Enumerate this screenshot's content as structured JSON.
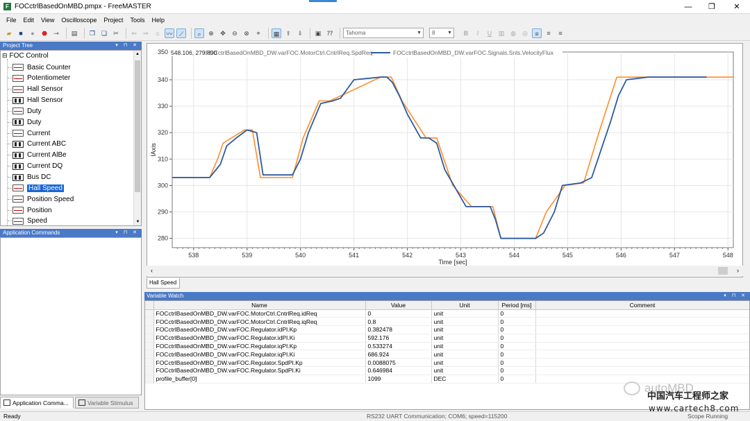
{
  "window": {
    "title": "FOCctrlBasedOnMBD.pmpx - FreeMASTER",
    "icon": "freemaster-app-icon",
    "controls": [
      "—",
      "❐",
      "✕"
    ]
  },
  "menu": [
    "File",
    "Edit",
    "View",
    "Oscilloscope",
    "Project",
    "Tools",
    "Help"
  ],
  "toolbar": {
    "font_name": "Tahoma",
    "font_size": "8"
  },
  "project_tree": {
    "header": "Project Tree",
    "root": "FOC Control",
    "selected": "Hall Speed",
    "items": [
      {
        "label": "Basic Counter",
        "icon": "oscilloscope-icon"
      },
      {
        "label": "Potentiometer",
        "icon": "oscilloscope-icon"
      },
      {
        "label": "Hall Sensor",
        "icon": "oscilloscope-icon"
      },
      {
        "label": "Hall Sensor",
        "icon": "recorder-icon"
      },
      {
        "label": "Duty",
        "icon": "oscilloscope-icon"
      },
      {
        "label": "Duty",
        "icon": "recorder-icon"
      },
      {
        "label": "Current",
        "icon": "oscilloscope-icon"
      },
      {
        "label": "Current ABC",
        "icon": "recorder-icon"
      },
      {
        "label": "Current AlBe",
        "icon": "recorder-icon"
      },
      {
        "label": "Current DQ",
        "icon": "recorder-icon"
      },
      {
        "label": "Bus DC",
        "icon": "recorder-icon"
      },
      {
        "label": "Hall Speed",
        "icon": "oscilloscope-icon"
      },
      {
        "label": "Position Speed",
        "icon": "oscilloscope-icon"
      },
      {
        "label": "Position",
        "icon": "oscilloscope-icon"
      },
      {
        "label": "Speed",
        "icon": "oscilloscope-icon"
      }
    ]
  },
  "app_commands": {
    "header": "Application Commands"
  },
  "bottom_tabs": [
    "Application Comma...",
    "Variable Stimulus"
  ],
  "scope": {
    "tab": "Hall Speed",
    "cursor_readout": "548.106, 279.890"
  },
  "chart_data": {
    "type": "line",
    "xlabel": "Time [sec]",
    "ylabel": "IAxis",
    "xlim": [
      537.6,
      548.1
    ],
    "ylim": [
      276.5,
      350.5
    ],
    "x_ticks": [
      538,
      539,
      540,
      541,
      542,
      543,
      544,
      545,
      546,
      547,
      548
    ],
    "y_ticks": [
      280,
      290,
      300,
      310,
      320,
      330,
      340
    ],
    "y_top_partial_tick": "350",
    "grid": true,
    "legend": "top",
    "series": [
      {
        "name": "FOCctrlBasedOnMBD_DW.varFOC.MotorCtrl.CntrlReq.SpdReq",
        "color": "#ff8c2a",
        "x": [
          537.6,
          538.3,
          538.45,
          538.55,
          538.95,
          539.1,
          539.25,
          539.85,
          540.05,
          540.35,
          540.55,
          541.5,
          541.7,
          541.9,
          542.35,
          542.55,
          542.85,
          543.2,
          543.6,
          543.75,
          544.4,
          544.6,
          544.95,
          545.3,
          545.6,
          545.92,
          548.1
        ],
        "y": [
          303,
          303,
          310,
          316,
          321,
          321,
          303,
          303,
          318,
          332,
          332,
          341,
          341,
          332,
          318,
          318,
          300,
          292,
          292,
          280,
          280,
          290,
          300,
          301,
          321,
          341,
          341
        ]
      },
      {
        "name": "FOCctrlBasedOnMBD_DW.varFOC.Signals.Snls.VelocityFlux",
        "color": "#2c5aa0",
        "x": [
          537.6,
          538.3,
          538.5,
          538.62,
          538.8,
          539.0,
          539.18,
          539.3,
          539.85,
          540.0,
          540.15,
          540.38,
          540.6,
          540.75,
          541.0,
          541.5,
          541.62,
          541.72,
          541.85,
          542.0,
          542.25,
          542.4,
          542.55,
          542.7,
          542.9,
          543.1,
          543.25,
          543.55,
          543.65,
          543.75,
          544.4,
          544.55,
          544.75,
          544.9,
          545.25,
          545.45,
          545.6,
          545.8,
          545.95,
          546.1,
          546.5,
          547.0,
          547.6
        ],
        "y": [
          303,
          303,
          308,
          315,
          318,
          321,
          320,
          304,
          304,
          310,
          320,
          331,
          332,
          333,
          340,
          341,
          341,
          339,
          334,
          327,
          318,
          318,
          316,
          306,
          299,
          292,
          292,
          292,
          287,
          280,
          280,
          282,
          290,
          300,
          301,
          303,
          312,
          324,
          334,
          340,
          341,
          341,
          341
        ]
      }
    ]
  },
  "variable_watch": {
    "header": "Variable Watch",
    "columns": [
      "Name",
      "Value",
      "Unit",
      "Period [ms]",
      "Comment"
    ],
    "rows": [
      [
        "FOCctrlBasedOnMBD_DW.varFOC.MotorCtrl.CntrlReq.idReq",
        "0",
        "unit",
        "0",
        ""
      ],
      [
        "FOCctrlBasedOnMBD_DW.varFOC.MotorCtrl.CntrlReq.iqReq",
        "0.8",
        "unit",
        "0",
        ""
      ],
      [
        "FOCctrlBasedOnMBD_DW.varFOC.Regulator.idPI.Kp",
        "0.382478",
        "unit",
        "0",
        ""
      ],
      [
        "FOCctrlBasedOnMBD_DW.varFOC.Regulator.idPI.Ki",
        "592.176",
        "unit",
        "0",
        ""
      ],
      [
        "FOCctrlBasedOnMBD_DW.varFOC.Regulator.iqPI.Kp",
        "0.533274",
        "unit",
        "0",
        ""
      ],
      [
        "FOCctrlBasedOnMBD_DW.varFOC.Regulator.iqPI.Ki",
        "686.924",
        "unit",
        "0",
        ""
      ],
      [
        "FOCctrlBasedOnMBD_DW.varFOC.Regulator.SpdPI.Kp",
        "0.0088075",
        "unit",
        "0",
        ""
      ],
      [
        "FOCctrlBasedOnMBD_DW.varFOC.Regulator.SpdPI.Ki",
        "0.646984",
        "unit",
        "0",
        ""
      ],
      [
        "profile_buffer[0]",
        "1099",
        "DEC",
        "0",
        ""
      ]
    ]
  },
  "status": {
    "left": "Ready",
    "connection": "RS232 UART Communication; COM6; speed=115200",
    "right": "Scope Running"
  },
  "watermark": {
    "brand": "autoMBD",
    "cn": "中国汽车工程师之家",
    "url": "www.cartech8.com"
  }
}
